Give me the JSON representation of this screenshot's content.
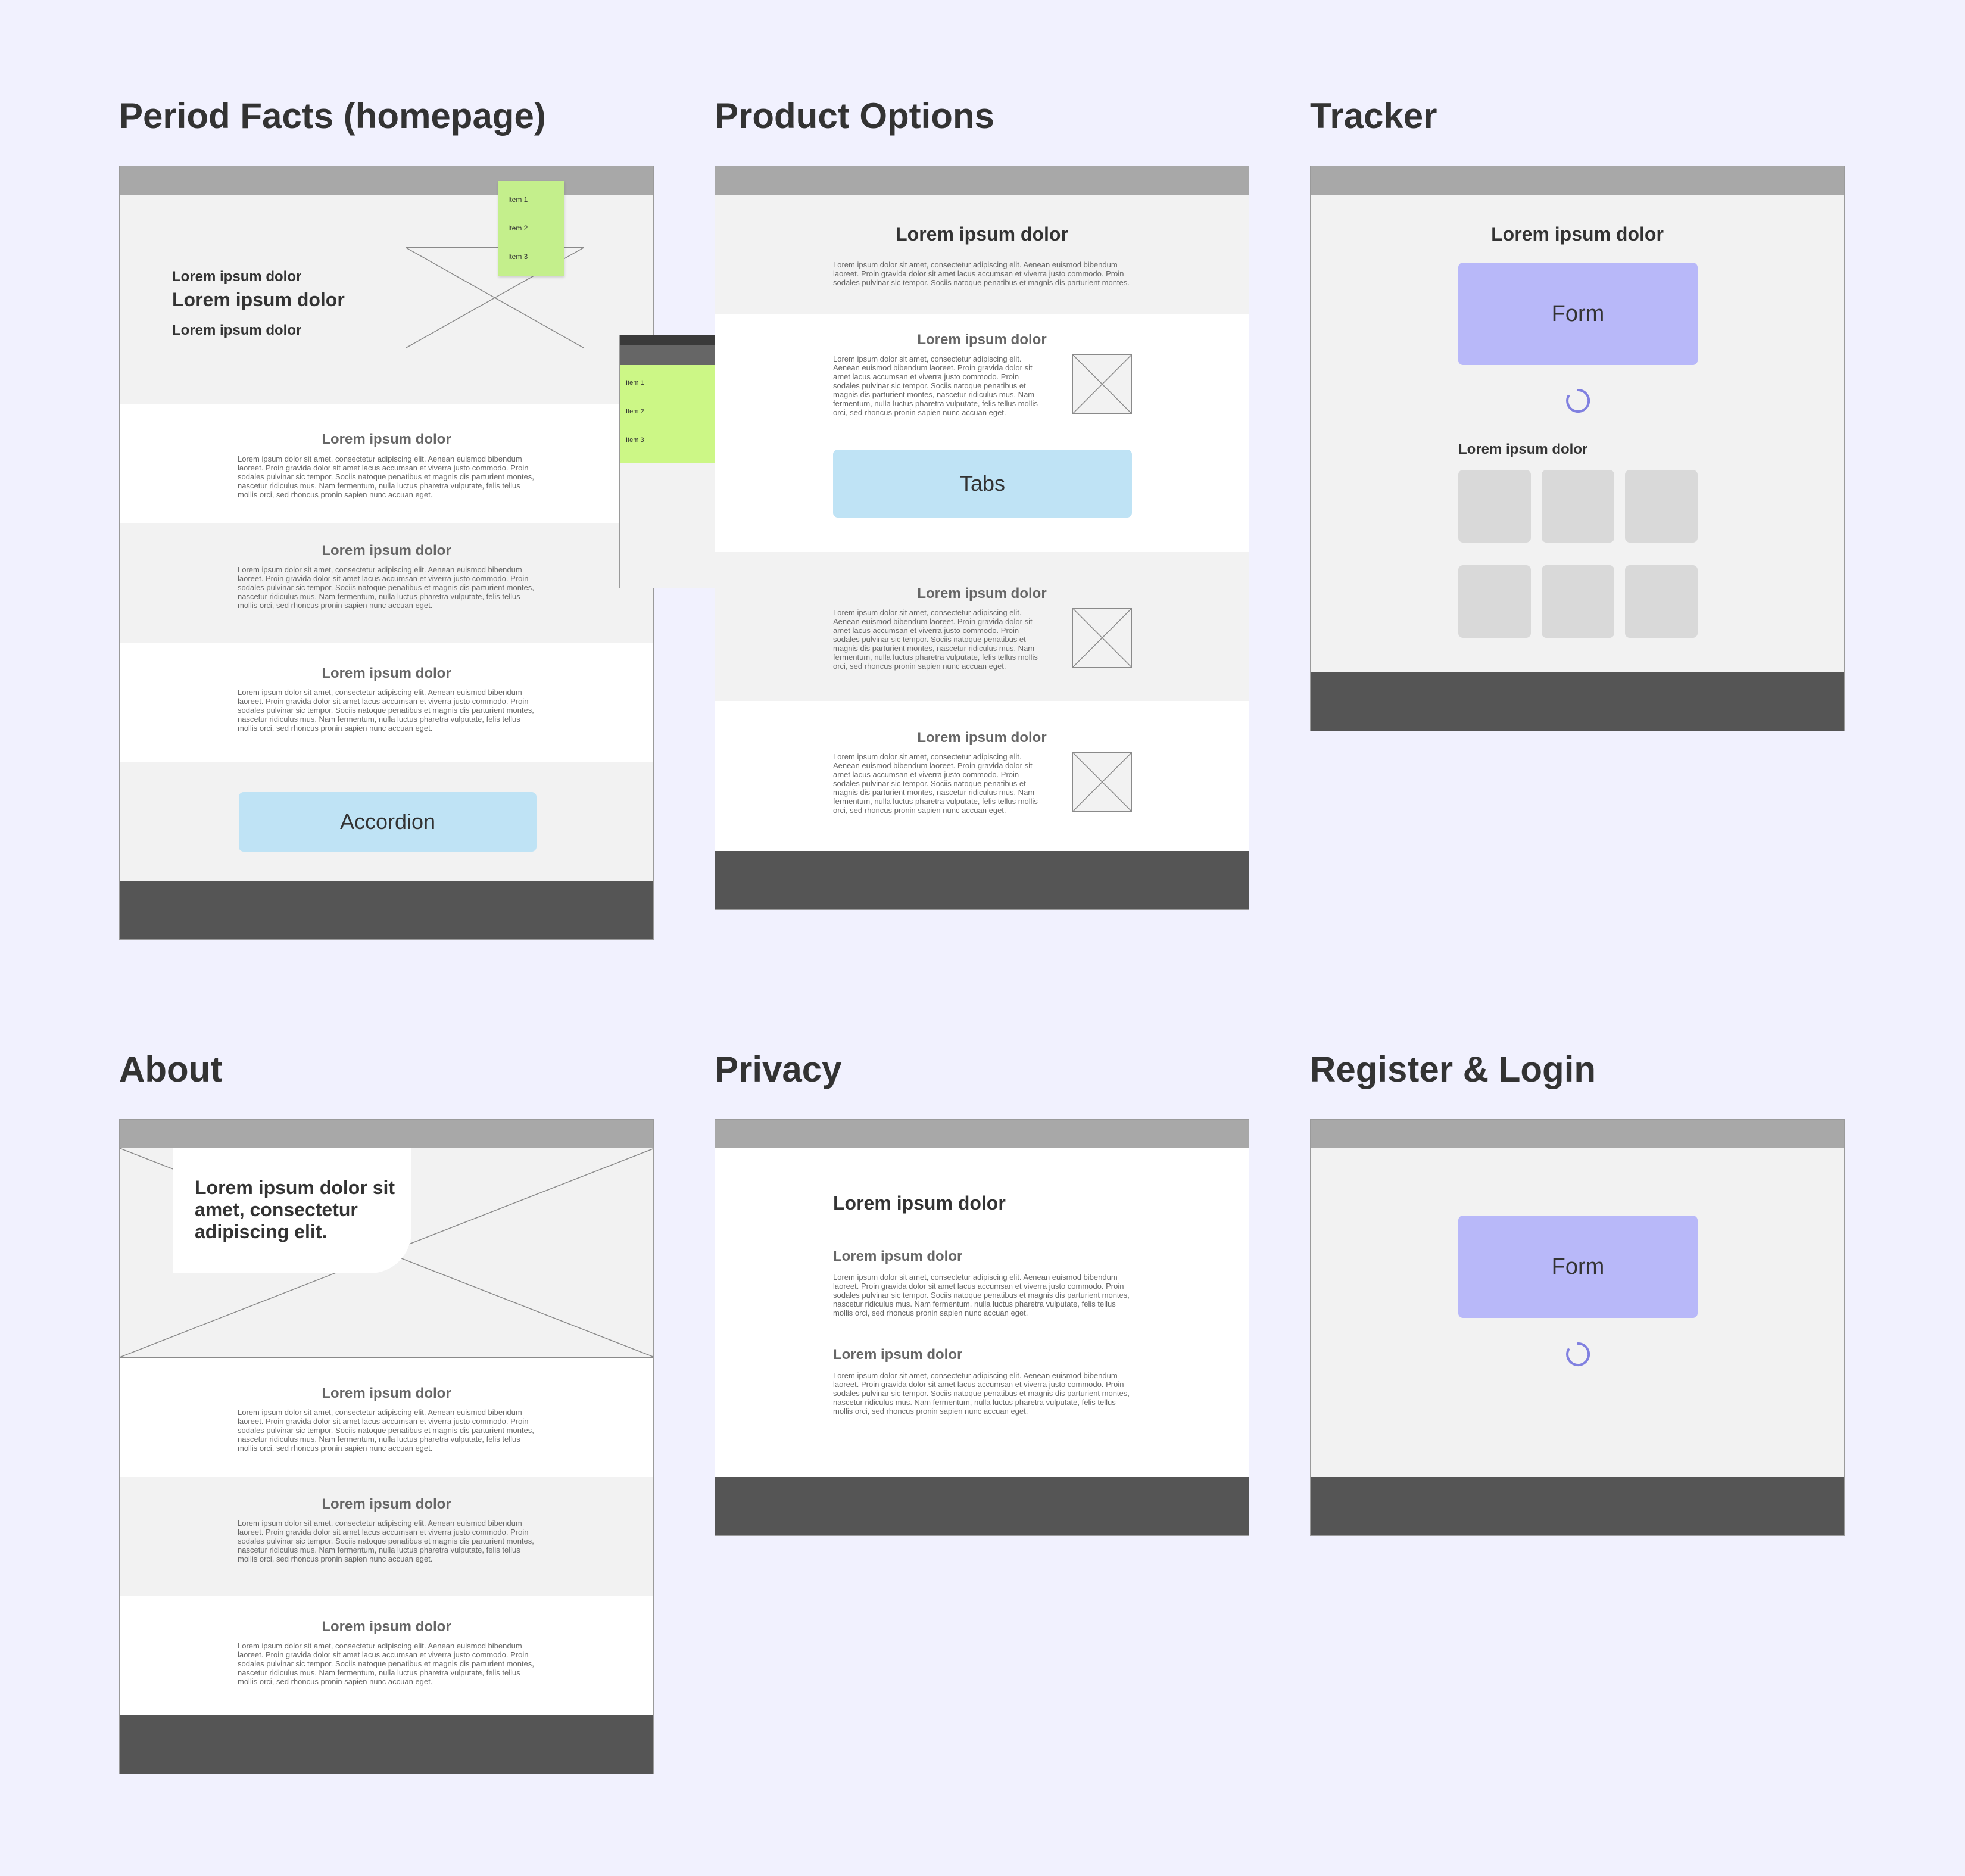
{
  "pages": {
    "homepage": {
      "title": "Period Facts (homepage)",
      "hero": {
        "line1": "Lorem ipsum dolor",
        "line2": "Lorem ipsum dolor",
        "line3": "Lorem ipsum dolor"
      },
      "dropdown_items": [
        "Item 1",
        "Item 2",
        "Item 3"
      ],
      "sections": [
        {
          "heading": "Lorem ipsum dolor",
          "body": "Lorem ipsum dolor sit amet, consectetur adipiscing elit. Aenean euismod bibendum laoreet. Proin gravida dolor sit amet lacus accumsan et viverra justo commodo. Proin sodales pulvinar sic tempor. Sociis natoque penatibus et magnis dis parturient montes, nascetur ridiculus mus. Nam fermentum, nulla luctus pharetra vulputate, felis tellus mollis orci, sed rhoncus pronin sapien nunc accuan eget."
        },
        {
          "heading": "Lorem ipsum dolor",
          "body": "Lorem ipsum dolor sit amet, consectetur adipiscing elit. Aenean euismod bibendum laoreet. Proin gravida dolor sit amet lacus accumsan et viverra justo commodo. Proin sodales pulvinar sic tempor. Sociis natoque penatibus et magnis dis parturient montes, nascetur ridiculus mus. Nam fermentum, nulla luctus pharetra vulputate, felis tellus mollis orci, sed rhoncus pronin sapien nunc accuan eget."
        },
        {
          "heading": "Lorem ipsum dolor",
          "body": "Lorem ipsum dolor sit amet, consectetur adipiscing elit. Aenean euismod bibendum laoreet. Proin gravida dolor sit amet lacus accumsan et viverra justo commodo. Proin sodales pulvinar sic tempor. Sociis natoque penatibus et magnis dis parturient montes, nascetur ridiculus mus. Nam fermentum, nulla luctus pharetra vulputate, felis tellus mollis orci, sed rhoncus pronin sapien nunc accuan eget."
        }
      ],
      "accordion_label": "Accordion",
      "mobile_menu": {
        "hamburger": "≡",
        "items": [
          "Item 1",
          "Item 2",
          "Item 3"
        ]
      }
    },
    "product_options": {
      "title": "Product Options",
      "intro": {
        "heading": "Lorem ipsum dolor",
        "body": "Lorem ipsum dolor sit amet, consectetur adipiscing elit. Aenean euismod bibendum laoreet. Proin gravida dolor sit amet lacus accumsan et viverra justo commodo. Proin sodales pulvinar sic tempor. Sociis natoque penatibus et magnis dis parturient montes."
      },
      "sections": [
        {
          "heading": "Lorem ipsum dolor",
          "body": "Lorem ipsum dolor sit amet, consectetur adipiscing elit. Aenean euismod bibendum laoreet. Proin gravida dolor sit amet lacus accumsan et viverra justo commodo. Proin sodales pulvinar sic tempor. Sociis natoque penatibus et magnis dis parturient montes, nascetur ridiculus mus. Nam fermentum, nulla luctus pharetra vulputate, felis tellus mollis orci, sed rhoncus pronin sapien nunc accuan eget."
        },
        {
          "heading": "Lorem ipsum dolor",
          "body": "Lorem ipsum dolor sit amet, consectetur adipiscing elit. Aenean euismod bibendum laoreet. Proin gravida dolor sit amet lacus accumsan et viverra justo commodo. Proin sodales pulvinar sic tempor. Sociis natoque penatibus et magnis dis parturient montes, nascetur ridiculus mus. Nam fermentum, nulla luctus pharetra vulputate, felis tellus mollis orci, sed rhoncus pronin sapien nunc accuan eget."
        },
        {
          "heading": "Lorem ipsum dolor",
          "body": "Lorem ipsum dolor sit amet, consectetur adipiscing elit. Aenean euismod bibendum laoreet. Proin gravida dolor sit amet lacus accumsan et viverra justo commodo. Proin sodales pulvinar sic tempor. Sociis natoque penatibus et magnis dis parturient montes, nascetur ridiculus mus. Nam fermentum, nulla luctus pharetra vulputate, felis tellus mollis orci, sed rhoncus pronin sapien nunc accuan eget."
        }
      ],
      "tabs_label": "Tabs"
    },
    "tracker": {
      "title": "Tracker",
      "heading": "Lorem ipsum dolor",
      "form_label": "Form",
      "subheading": "Lorem ipsum dolor"
    },
    "about": {
      "title": "About",
      "hero_text": "Lorem ipsum dolor sit amet, consectetur adipiscing elit.",
      "sections": [
        {
          "heading": "Lorem ipsum dolor",
          "body": "Lorem ipsum dolor sit amet, consectetur adipiscing elit. Aenean euismod bibendum laoreet. Proin gravida dolor sit amet lacus accumsan et viverra justo commodo. Proin sodales pulvinar sic tempor. Sociis natoque penatibus et magnis dis parturient montes, nascetur ridiculus mus. Nam fermentum, nulla luctus pharetra vulputate, felis tellus mollis orci, sed rhoncus pronin sapien nunc accuan eget."
        },
        {
          "heading": "Lorem ipsum dolor",
          "body": "Lorem ipsum dolor sit amet, consectetur adipiscing elit. Aenean euismod bibendum laoreet. Proin gravida dolor sit amet lacus accumsan et viverra justo commodo. Proin sodales pulvinar sic tempor. Sociis natoque penatibus et magnis dis parturient montes, nascetur ridiculus mus. Nam fermentum, nulla luctus pharetra vulputate, felis tellus mollis orci, sed rhoncus pronin sapien nunc accuan eget."
        },
        {
          "heading": "Lorem ipsum dolor",
          "body": "Lorem ipsum dolor sit amet, consectetur adipiscing elit. Aenean euismod bibendum laoreet. Proin gravida dolor sit amet lacus accumsan et viverra justo commodo. Proin sodales pulvinar sic tempor. Sociis natoque penatibus et magnis dis parturient montes, nascetur ridiculus mus. Nam fermentum, nulla luctus pharetra vulputate, felis tellus mollis orci, sed rhoncus pronin sapien nunc accuan eget."
        }
      ]
    },
    "privacy": {
      "title": "Privacy",
      "heading": "Lorem ipsum dolor",
      "sections": [
        {
          "heading": "Lorem ipsum dolor",
          "body": "Lorem ipsum dolor sit amet, consectetur adipiscing elit. Aenean euismod bibendum laoreet. Proin gravida dolor sit amet lacus accumsan et viverra justo commodo. Proin sodales pulvinar sic tempor. Sociis natoque penatibus et magnis dis parturient montes, nascetur ridiculus mus. Nam fermentum, nulla luctus pharetra vulputate, felis tellus mollis orci, sed rhoncus pronin sapien nunc accuan eget."
        },
        {
          "heading": "Lorem ipsum dolor",
          "body": "Lorem ipsum dolor sit amet, consectetur adipiscing elit. Aenean euismod bibendum laoreet. Proin gravida dolor sit amet lacus accumsan et viverra justo commodo. Proin sodales pulvinar sic tempor. Sociis natoque penatibus et magnis dis parturient montes, nascetur ridiculus mus. Nam fermentum, nulla luctus pharetra vulputate, felis tellus mollis orci, sed rhoncus pronin sapien nunc accuan eget."
        }
      ]
    },
    "register_login": {
      "title": "Register & Login",
      "form_label": "Form"
    }
  },
  "colors": {
    "background": "#f1f1fe",
    "topbar": "#a8a8a8",
    "footer": "#555555",
    "accordion_tabs": "#bfe3f5",
    "form": "#b8b8f9",
    "menu_green": "#ccf786",
    "spinner": "#8080e0"
  }
}
